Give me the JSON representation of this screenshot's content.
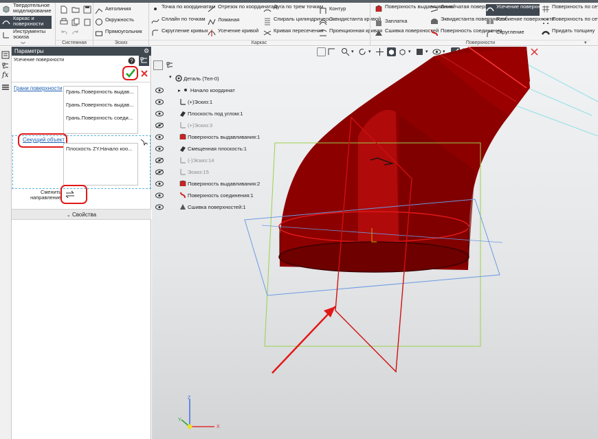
{
  "ribbon": {
    "modes": [
      {
        "label": "Твердотельное моделирование",
        "icon": "solid-icon"
      },
      {
        "label": "Каркас и поверхности",
        "icon": "surface-icon",
        "active": true
      },
      {
        "label": "Инструменты эскиза",
        "icon": "sketch-tools-icon"
      }
    ],
    "groups": {
      "system": "Системная",
      "sketch": "Эскиз",
      "frame": "Каркас",
      "surfaces": "Поверхности"
    },
    "sketch_buttons": [
      "Автолиния",
      "Окружность",
      "Прямоугольник"
    ],
    "frame_col1": [
      "Точка по координатам",
      "Сплайн по точкам",
      "Скругление кривых"
    ],
    "frame_col2": [
      "Отрезок по координатам",
      "Ломаная",
      "Усечение кривой"
    ],
    "frame_col3": [
      "Дуга по трем точкам",
      "Спираль цилиндрическ...",
      "Кривая пересечения"
    ],
    "frame_col4": [
      "Контур",
      "Эквидистанта кривой",
      "Проекционная кривая"
    ],
    "surf_col1": [
      "Поверхность выдавливания",
      "Заплатка",
      "Сшивка поверхностей"
    ],
    "surf_col2": [
      "Линейчатая поверхность",
      "Эквидистанта поверхности",
      "Поверхность соединения"
    ],
    "surf_col3": [
      "Усечение поверхности",
      "Разбиение поверхности",
      "Скругление"
    ],
    "surf_col4": [
      "Поверхность по сети кривых",
      "Поверхность по сети точек",
      "Придать толщину"
    ]
  },
  "panel": {
    "title": "Параметры",
    "operation": "Усечение поверхности",
    "faces_label": "Грани поверхности",
    "faces": [
      "Грань.Поверхность выдав...",
      "Грань.Поверхность выдав...",
      "Грань.Поверхность соеди..."
    ],
    "cutter_label": "Секущий объект",
    "cutter_items": [
      "Плоскость ZY.Начало коо..."
    ],
    "direction_label": "Сменить направление",
    "properties_label": "Свойства"
  },
  "tree": {
    "root": "Деталь (Тел-0)",
    "items": [
      {
        "label": "Начало координат",
        "icon": "origin-icon",
        "dim": false
      },
      {
        "label": "(+)Эскиз:1",
        "icon": "sketch-icon",
        "dim": false
      },
      {
        "label": "Плоскость под углом:1",
        "icon": "plane-icon",
        "dim": false
      },
      {
        "label": "(+)Эскиз:3",
        "icon": "sketch-icon",
        "dim": true
      },
      {
        "label": "Поверхность выдавливания:1",
        "icon": "extrude-surface-icon",
        "dim": false
      },
      {
        "label": "Смещенная плоскость:1",
        "icon": "plane-icon",
        "dim": false
      },
      {
        "label": "(-)Эскиз:14",
        "icon": "sketch-icon",
        "dim": true
      },
      {
        "label": "Эскиз:15",
        "icon": "sketch-icon",
        "dim": true
      },
      {
        "label": "Поверхность выдавливания:2",
        "icon": "extrude-surface-icon",
        "dim": false
      },
      {
        "label": "Поверхность соединения:1",
        "icon": "join-surface-icon",
        "dim": false
      },
      {
        "label": "Сшивка поверхностей:1",
        "icon": "stitch-icon",
        "dim": false
      }
    ]
  },
  "axes": {
    "x": "X",
    "y": "Y",
    "z": "Z"
  },
  "colors": {
    "accent": "#3f4750",
    "part": "#a00000",
    "red_mark": "#e21818",
    "apply": "#2aa32a"
  }
}
